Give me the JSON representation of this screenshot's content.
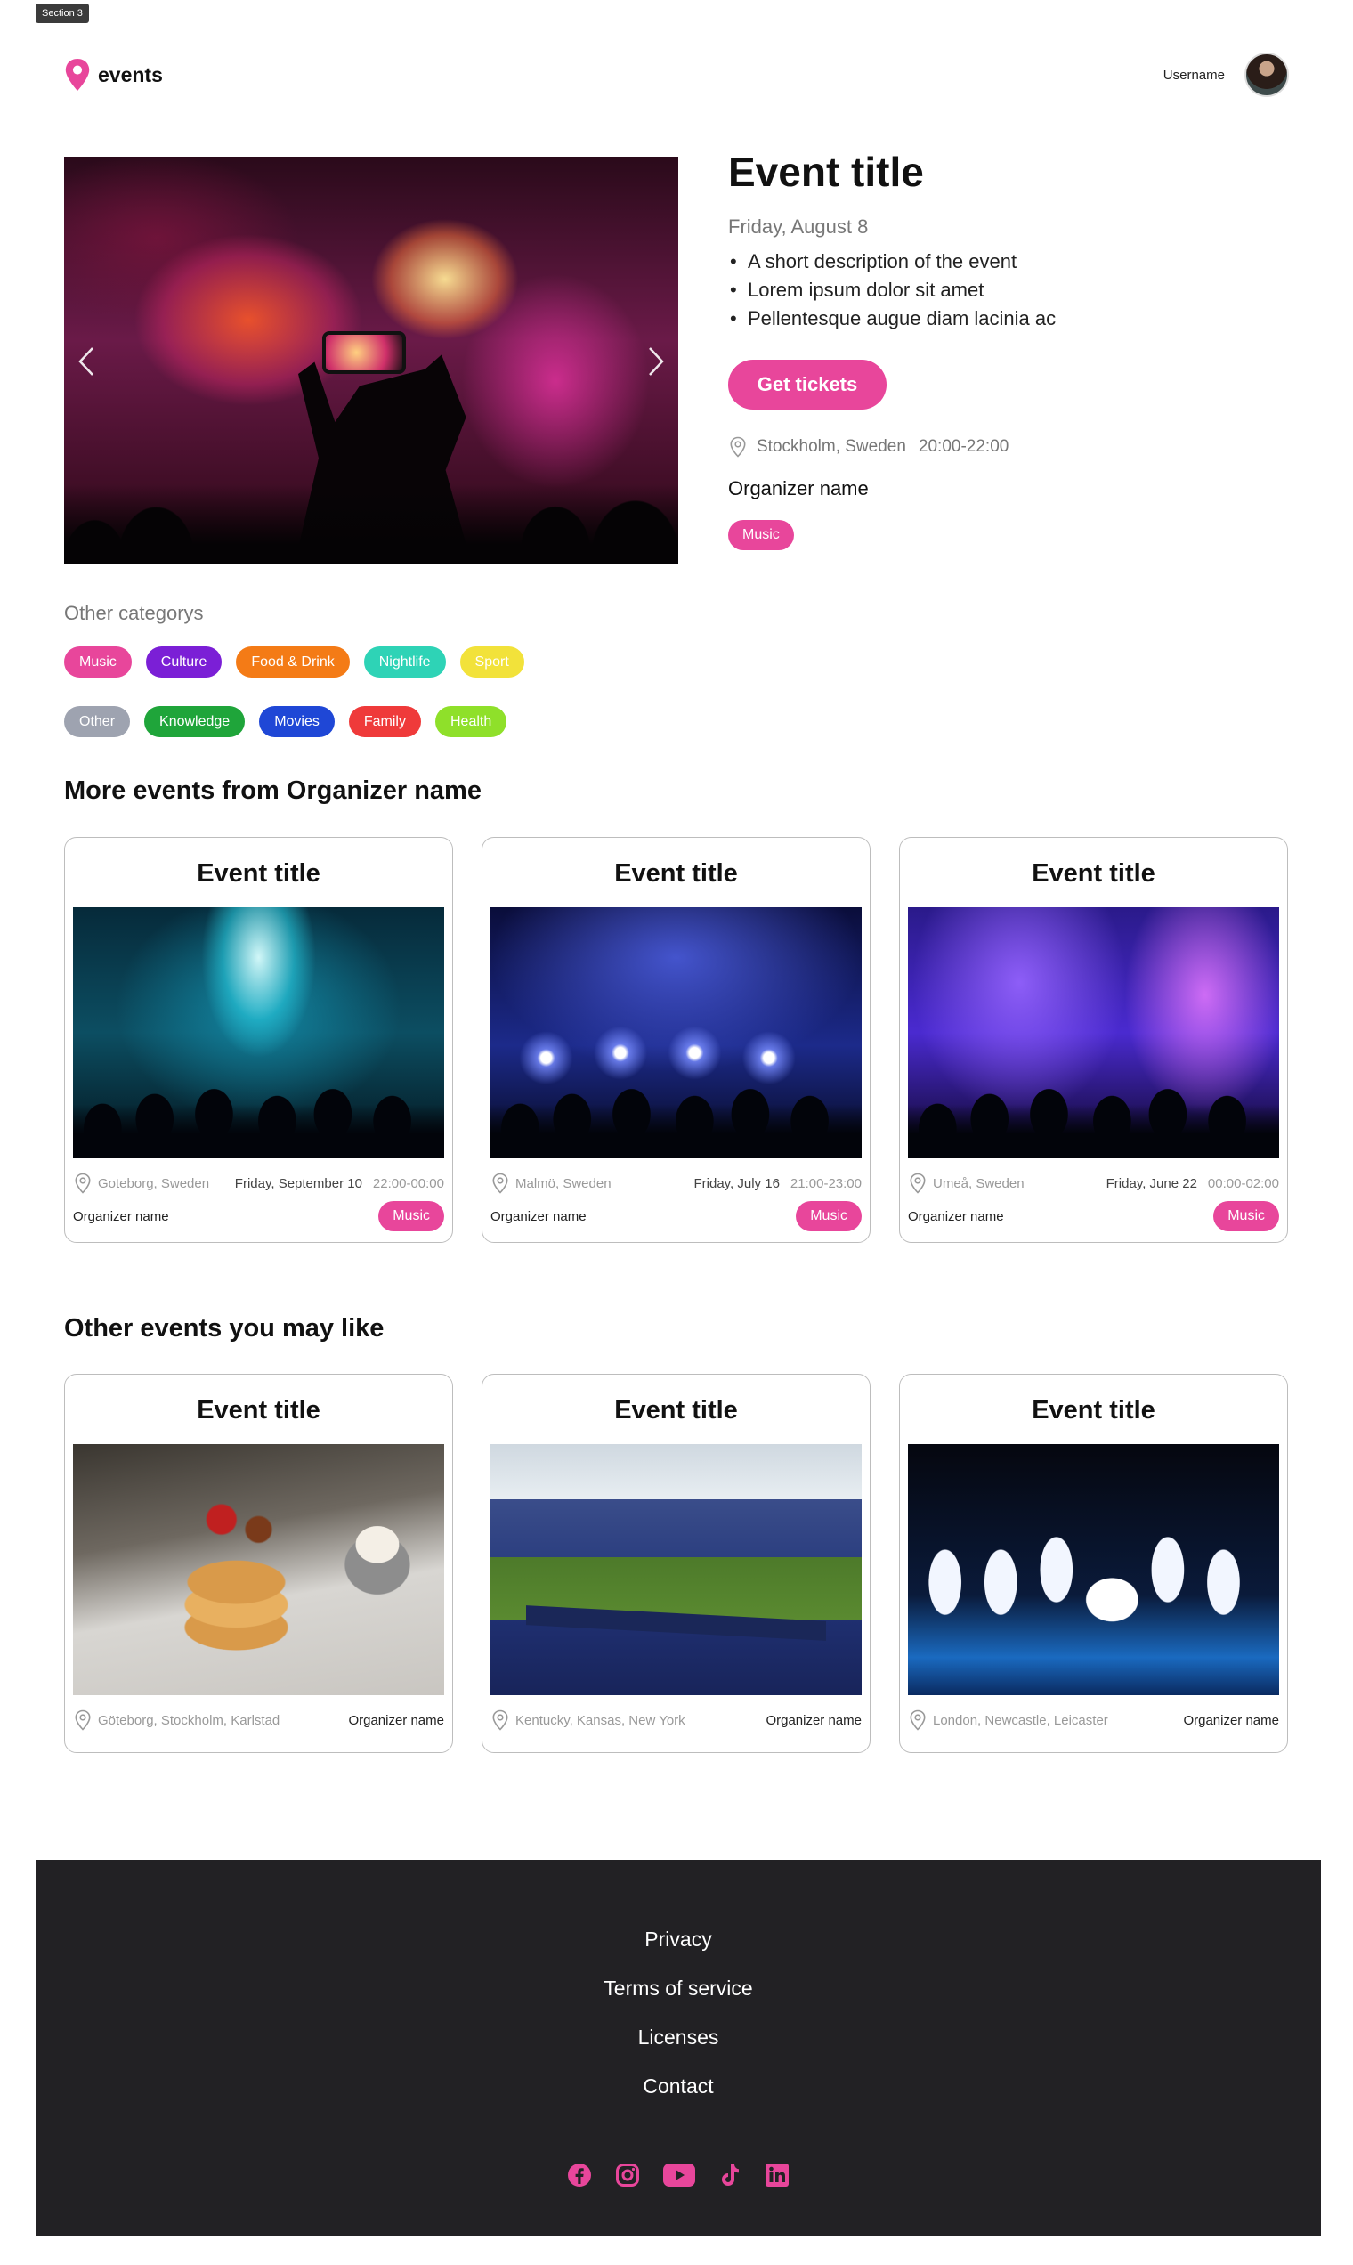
{
  "section_tag": "Section 3",
  "header": {
    "logo_text": "events",
    "username": "Username"
  },
  "hero": {
    "title": "Event title",
    "date": "Friday, August 8",
    "description": [
      "A short description of the event",
      "Lorem ipsum dolor sit amet",
      "Pellentesque augue diam lacinia ac"
    ],
    "tickets_label": "Get tickets",
    "location": "Stockholm, Sweden",
    "time": "20:00-22:00",
    "organizer": "Organizer name",
    "category": "Music",
    "carousel_prev_icon": "chevron-left-icon",
    "carousel_next_icon": "chevron-right-icon"
  },
  "categories": {
    "heading": "Other categorys",
    "items": [
      {
        "label": "Music",
        "color": "#e8469b"
      },
      {
        "label": "Culture",
        "color": "#7b1fd6"
      },
      {
        "label": "Food & Drink",
        "color": "#f47b16"
      },
      {
        "label": "Nightlife",
        "color": "#2ed3b6"
      },
      {
        "label": "Sport",
        "color": "#f2e23a"
      },
      {
        "label": "Other",
        "color": "#9ea3b0"
      },
      {
        "label": "Knowledge",
        "color": "#1fa53a"
      },
      {
        "label": "Movies",
        "color": "#1f47d6"
      },
      {
        "label": "Family",
        "color": "#ef3a3a"
      },
      {
        "label": "Health",
        "color": "#8fe02a"
      }
    ]
  },
  "more_events": {
    "heading": "More events from Organizer name",
    "cards": [
      {
        "title": "Event title",
        "location": "Goteborg, Sweden",
        "date": "Friday, September 10",
        "time": "22:00-00:00",
        "organizer": "Organizer name",
        "category": "Music"
      },
      {
        "title": "Event title",
        "location": "Malmö, Sweden",
        "date": "Friday, July 16",
        "time": "21:00-23:00",
        "organizer": "Organizer name",
        "category": "Music"
      },
      {
        "title": "Event title",
        "location": "Umeå, Sweden",
        "date": "Friday, June 22",
        "time": "00:00-02:00",
        "organizer": "Organizer name",
        "category": "Music"
      }
    ]
  },
  "other_events": {
    "heading": "Other events you may like",
    "cards": [
      {
        "title": "Event title",
        "location": "Göteborg, Stockholm, Karlstad",
        "organizer": "Organizer name"
      },
      {
        "title": "Event title",
        "location": "Kentucky, Kansas, New York",
        "organizer": "Organizer name"
      },
      {
        "title": "Event title",
        "location": "London, Newcastle, Leicaster",
        "organizer": "Organizer name"
      }
    ]
  },
  "footer": {
    "links": [
      "Privacy",
      "Terms of service",
      "Licenses",
      "Contact"
    ],
    "social_icons": [
      "facebook-icon",
      "instagram-icon",
      "youtube-icon",
      "tiktok-icon",
      "linkedin-icon"
    ],
    "accent": "#e8469b"
  }
}
